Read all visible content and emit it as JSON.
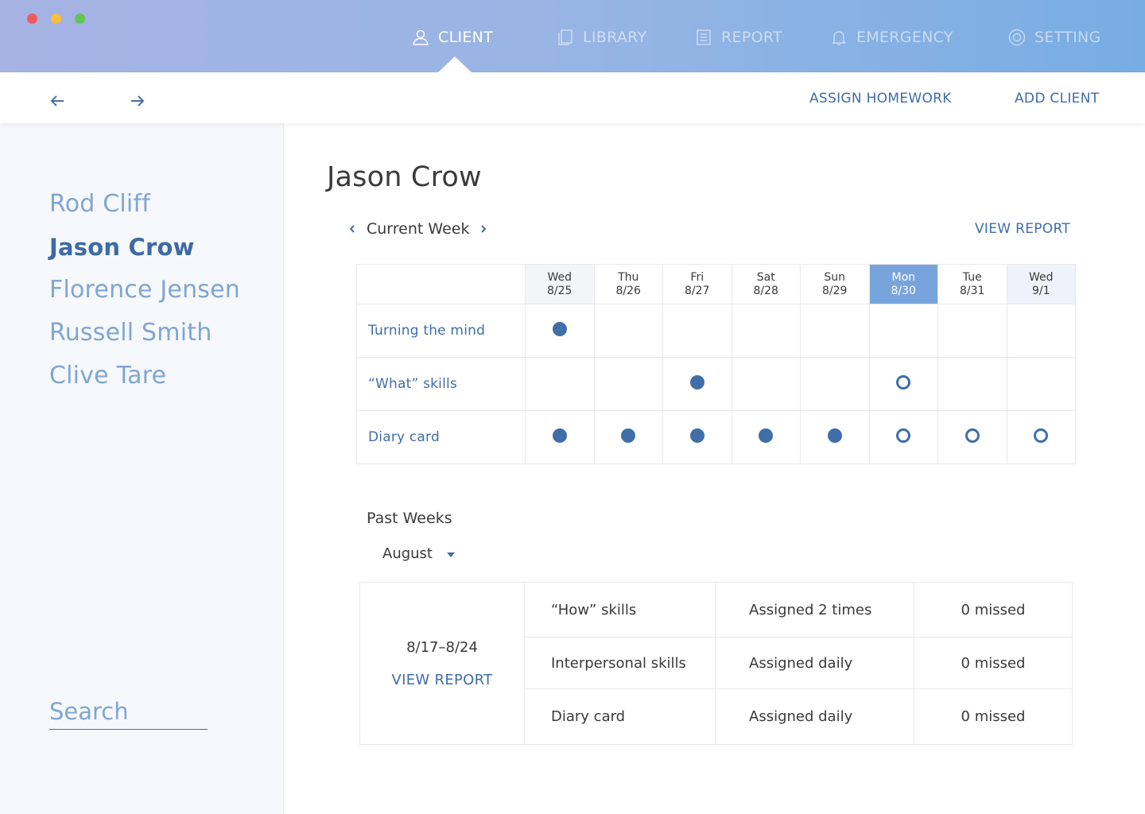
{
  "window": {
    "controls": [
      "close",
      "minimize",
      "maximize"
    ]
  },
  "nav": {
    "items": [
      {
        "label": "CLIENT",
        "icon": "user-icon",
        "active": true
      },
      {
        "label": "LIBRARY",
        "icon": "library-icon",
        "active": false
      },
      {
        "label": "REPORT",
        "icon": "report-icon",
        "active": false
      },
      {
        "label": "EMERGENCY",
        "icon": "bell-icon",
        "active": false
      },
      {
        "label": "SETTING",
        "icon": "gear-icon",
        "active": false
      }
    ]
  },
  "toolbar": {
    "back_icon": "arrow-left-icon",
    "forward_icon": "arrow-right-icon",
    "assign_homework": "ASSIGN HOMEWORK",
    "add_client": "ADD CLIENT"
  },
  "sidebar": {
    "clients": [
      {
        "name": "Rod Cliff",
        "selected": false
      },
      {
        "name": "Jason Crow",
        "selected": true
      },
      {
        "name": "Florence Jensen",
        "selected": false
      },
      {
        "name": "Russell Smith",
        "selected": false
      },
      {
        "name": "Clive Tare",
        "selected": false
      }
    ],
    "search_placeholder": "Search"
  },
  "main": {
    "title": "Jason Crow",
    "current_week": {
      "label": "Current Week",
      "view_report": "VIEW REPORT",
      "days": [
        {
          "dow": "Wed",
          "date": "8/25"
        },
        {
          "dow": "Thu",
          "date": "8/26"
        },
        {
          "dow": "Fri",
          "date": "8/27"
        },
        {
          "dow": "Sat",
          "date": "8/28"
        },
        {
          "dow": "Sun",
          "date": "8/29"
        },
        {
          "dow": "Mon",
          "date": "8/30"
        },
        {
          "dow": "Tue",
          "date": "8/31"
        },
        {
          "dow": "Wed",
          "date": "9/1"
        }
      ],
      "tasks": [
        {
          "name": "Turning the mind",
          "status": [
            "done",
            "",
            "",
            "",
            "",
            "",
            "",
            ""
          ]
        },
        {
          "name": "“What” skills",
          "status": [
            "",
            "",
            "done",
            "",
            "",
            "pending",
            "",
            ""
          ]
        },
        {
          "name": "Diary card",
          "status": [
            "done",
            "done",
            "done",
            "done",
            "done",
            "pending",
            "pending",
            "pending"
          ]
        }
      ]
    },
    "past_weeks": {
      "label": "Past Weeks",
      "month": "August",
      "entries": [
        {
          "range": "8/17–8/24",
          "view_report": "VIEW REPORT",
          "rows": [
            {
              "homework": "“How” skills",
              "frequency": "Assigned 2 times",
              "missed": "0 missed"
            },
            {
              "homework": "Interpersonal skills",
              "frequency": "Assigned daily",
              "missed": "0 missed"
            },
            {
              "homework": "Diary card",
              "frequency": "Assigned daily",
              "missed": "0 missed"
            }
          ]
        }
      ]
    }
  },
  "colors": {
    "accent": "#3f6ea8",
    "accent_light": "#7fa6d3",
    "today_header": "#78a4dc",
    "topbar_start": "#a6b3e3",
    "topbar_end": "#78ade3"
  }
}
